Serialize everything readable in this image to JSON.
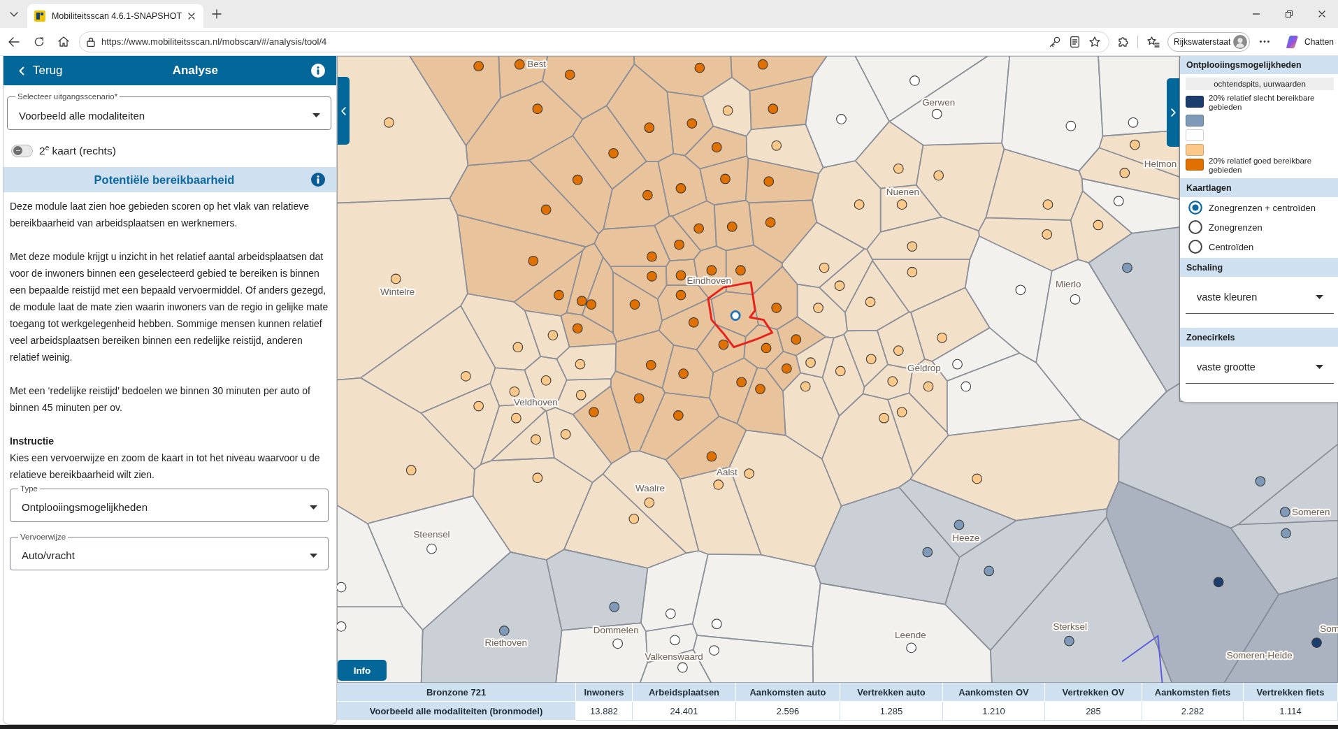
{
  "browser": {
    "tabs": [
      {
        "title": "Mobiliteitsscan 4.6.1-SNAPSHOT",
        "selected": true
      }
    ],
    "url": "https://www.mobiliteitsscan.nl/mobscan/#/analysis/tool/4",
    "profile": "Rijkswaterstaat",
    "chat": "Chatten"
  },
  "panel": {
    "back": "Terug",
    "title": "Analyse",
    "scenario": {
      "label": "Selecteer uitgangsscenario*",
      "value": "Voorbeeld alle modaliteiten"
    },
    "toggle": {
      "label": "2$^{e}$ kaart (rechts)",
      "on": false
    },
    "section": "Potentiële bereikbaarheid",
    "paragraphs": [
      "Deze module laat zien hoe gebieden scoren op het vlak van relatieve bereikbaarheid van arbeidsplaatsen en werknemers.",
      "Met deze module krijgt u inzicht in het relatief aantal arbeidsplaatsen dat voor de inwoners binnen een geselecteerd gebied te bereiken is binnen een bepaalde reistijd met een bepaald vervoermiddel. Of anders gezegd, de module laat de mate zien waarin inwoners van de regio in gelijke mate toegang tot werkgelegenheid hebben. Sommige mensen kunnen relatief veel arbeidsplaatsen bereiken binnen een redelijke reistijd, anderen relatief weinig.",
      "Met een ‘redelijke reistijd’ bedoelen we binnen 30 minuten per auto of binnen 45 minuten per ov."
    ],
    "instruction": {
      "heading": "Instructie",
      "text": "Kies een vervoerwijze en zoom de kaart in tot het niveau waarvoor u de relatieve bereikbaarheid wilt zien."
    },
    "fields": [
      {
        "label": "Type",
        "value": "Ontplooiingsmogelijkheden"
      },
      {
        "label": "Vervoerwijze",
        "value": "Auto/vracht"
      }
    ]
  },
  "map": {
    "places": [
      "Best",
      "Wintelre",
      "Eindhoven",
      "Nuenen",
      "Gerwen",
      "Helmon",
      "Mierlo",
      "Geldrop",
      "Aalst",
      "Waalre",
      "Steensel",
      "Heeze",
      "Riethoven",
      "Dommelen",
      "Leende",
      "Sterksel",
      "Someren-Heide",
      "Someren",
      "Veldhoven",
      "Valkenswaard",
      "Som"
    ],
    "info_button": "Info"
  },
  "legend": {
    "title": "Ontplooiingsmogelijkheden",
    "subtitle": "ochtendspits, uurwaarden",
    "items": [
      {
        "color": "#1b3e6f",
        "label": "20% relatief slecht bereikbare gebieden"
      },
      {
        "color": "#7f99b8"
      },
      {
        "color": "#ffffff"
      },
      {
        "color": "#fcc98b"
      },
      {
        "color": "#e07000",
        "label": "20% relatief goed bereikbare gebieden"
      }
    ],
    "layers": {
      "title": "Kaartlagen",
      "options": [
        {
          "label": "Zonegrenzen + centroïden",
          "selected": true
        },
        {
          "label": "Zonegrenzen",
          "selected": false
        },
        {
          "label": "Centroïden",
          "selected": false
        }
      ]
    },
    "scaling": {
      "title": "Schaling",
      "value": "vaste kleuren"
    },
    "circles": {
      "title": "Zonecirkels",
      "value": "vaste grootte"
    }
  },
  "table": {
    "columns": [
      "Bronzone 721",
      "Inwoners",
      "Arbeidsplaatsen",
      "Aankomsten auto",
      "Vertrekken auto",
      "Aankomsten OV",
      "Vertrekken OV",
      "Aankomsten fiets",
      "Vertrekken fiets"
    ],
    "rows": [
      {
        "label": "Voorbeeld alle modaliteiten (bronmodel)",
        "values": [
          "13.882",
          "24.401",
          "2.596",
          "1.285",
          "1.210",
          "285",
          "2.282",
          "1.114"
        ]
      }
    ]
  }
}
